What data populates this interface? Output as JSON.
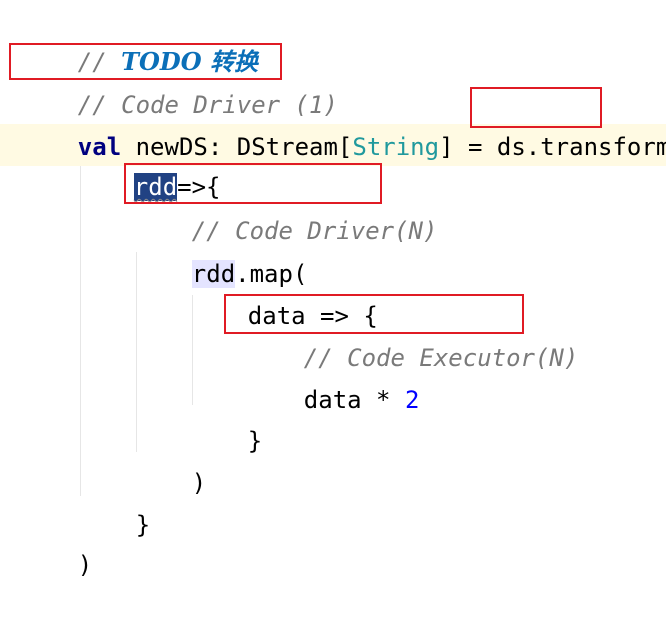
{
  "todo": {
    "marker": "// ",
    "text": "TODO 转换"
  },
  "comments": {
    "driver_1": "// Code Driver (1)",
    "driver_n": "// Code Driver(N)",
    "executor_n": "// Code Executor(N)"
  },
  "code": {
    "kw_val": "val",
    "var_name": "newDS",
    "colon": ": ",
    "type_dstream": "DStream",
    "bracket_open": "[",
    "type_string": "String",
    "bracket_close_eq": "] = ",
    "ds": "ds.",
    "transform": "transform",
    "paren_open": "(",
    "rdd_param": "rdd",
    "arrow_brace": "=>{",
    "rdd_ref": "rdd",
    "map_call": ".map(",
    "data_param": "data => {",
    "data_ident": "data",
    "times": " * ",
    "two": "2",
    "close_brace_inner": "}",
    "close_paren_map": ")",
    "close_brace_outer": "}",
    "close_paren_transform": ")"
  },
  "colors": {
    "todo": "#0b6fb8",
    "comment": "#7a7a7a",
    "keyword": "#000080",
    "type": "#20999d",
    "number": "#0000ff",
    "highlight_box": "#e01b24",
    "selection": "#214283"
  }
}
